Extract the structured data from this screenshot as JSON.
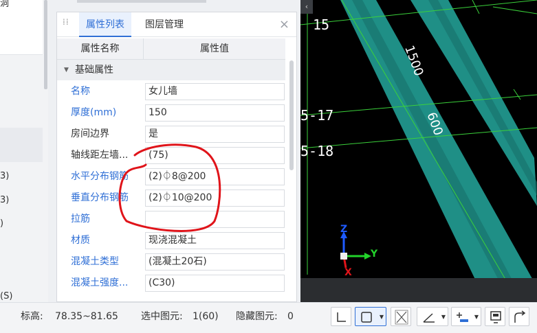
{
  "left_panel": {
    "items": [
      {
        "text": "洞"
      },
      {
        "text": "3)"
      },
      {
        "text": "3)"
      },
      {
        "text": ")"
      },
      {
        "text": "(S)"
      }
    ]
  },
  "property_panel": {
    "tabs": [
      {
        "label": "属性列表"
      },
      {
        "label": "图层管理"
      }
    ],
    "close_symbol": "×",
    "columns": {
      "name": "属性名称",
      "value": "属性值"
    },
    "group": "基础属性",
    "rows": [
      {
        "name": "名称",
        "value": "女儿墙",
        "blue": true
      },
      {
        "name": "厚度(mm)",
        "value": "150",
        "blue": true
      },
      {
        "name": "房间边界",
        "value": "是",
        "blue": false
      },
      {
        "name": "轴线距左墙...",
        "value": "(75)",
        "blue": false
      },
      {
        "name": "水平分布钢筋",
        "value": "(2)⏀8@200",
        "blue": true
      },
      {
        "name": "垂直分布钢筋",
        "value": "(2)⏀10@200",
        "blue": true
      },
      {
        "name": "拉筋",
        "value": "",
        "blue": true
      },
      {
        "name": "材质",
        "value": "现浇混凝土",
        "blue": true
      },
      {
        "name": "混凝土类型",
        "value": "(混凝土20石)",
        "blue": true
      },
      {
        "name": "混凝土强度...",
        "value": "(C30)",
        "blue": true
      }
    ]
  },
  "canvas": {
    "axis_labels": [
      "15",
      "5-17",
      "5-18"
    ],
    "dimension_labels": [
      "1500",
      "600"
    ],
    "coord_axes": {
      "z": "Z",
      "y": "Y",
      "x": "X"
    },
    "colors": {
      "grid": "#3bd23b",
      "wall": "#1f8f86",
      "annotation": "#e0141a"
    }
  },
  "status_bar": {
    "elevation_label": "标高:",
    "elevation_value": "78.35~81.65",
    "selected_label": "选中图元:",
    "selected_value": "1(60)",
    "hidden_label": "隐藏图元:",
    "hidden_value": "0"
  }
}
